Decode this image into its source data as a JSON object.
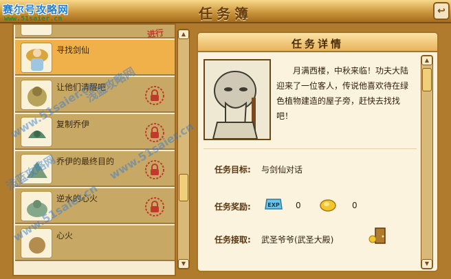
{
  "window": {
    "title": "任务簿",
    "logo_text": "赛尔号攻略网",
    "logo_url": "www.51saier.cn"
  },
  "quest_list": {
    "items": [
      {
        "label": "",
        "status": "进行",
        "locked": false,
        "selected": false
      },
      {
        "label": "寻找剑仙",
        "status": "",
        "locked": false,
        "selected": true
      },
      {
        "label": "让他们清醒吧",
        "status": "",
        "locked": true,
        "selected": false
      },
      {
        "label": "复制乔伊",
        "status": "",
        "locked": true,
        "selected": false
      },
      {
        "label": "乔伊的最终目的",
        "status": "",
        "locked": true,
        "selected": false
      },
      {
        "label": "逆水的心火",
        "status": "",
        "locked": true,
        "selected": false
      },
      {
        "label": "心火",
        "status": "",
        "locked": false,
        "selected": false
      }
    ]
  },
  "detail": {
    "header": "任务详情",
    "story": "月满西楼，中秋来临！功夫大陆迎来了一位客人，传说他喜欢待在绿色植物建造的屋子旁，赶快去找找吧！",
    "target_label": "任务目标:",
    "target_value": "与剑仙对话",
    "reward_label": "任务奖励:",
    "reward_exp_label": "EXP",
    "reward_exp_value": "0",
    "reward_coin_value": "0",
    "receiver_label": "任务接取:",
    "receiver_value": "武圣爷爷(武圣大殿)"
  },
  "watermarks": [
    "浅蓝攻略网",
    "www.51saier.cn"
  ]
}
